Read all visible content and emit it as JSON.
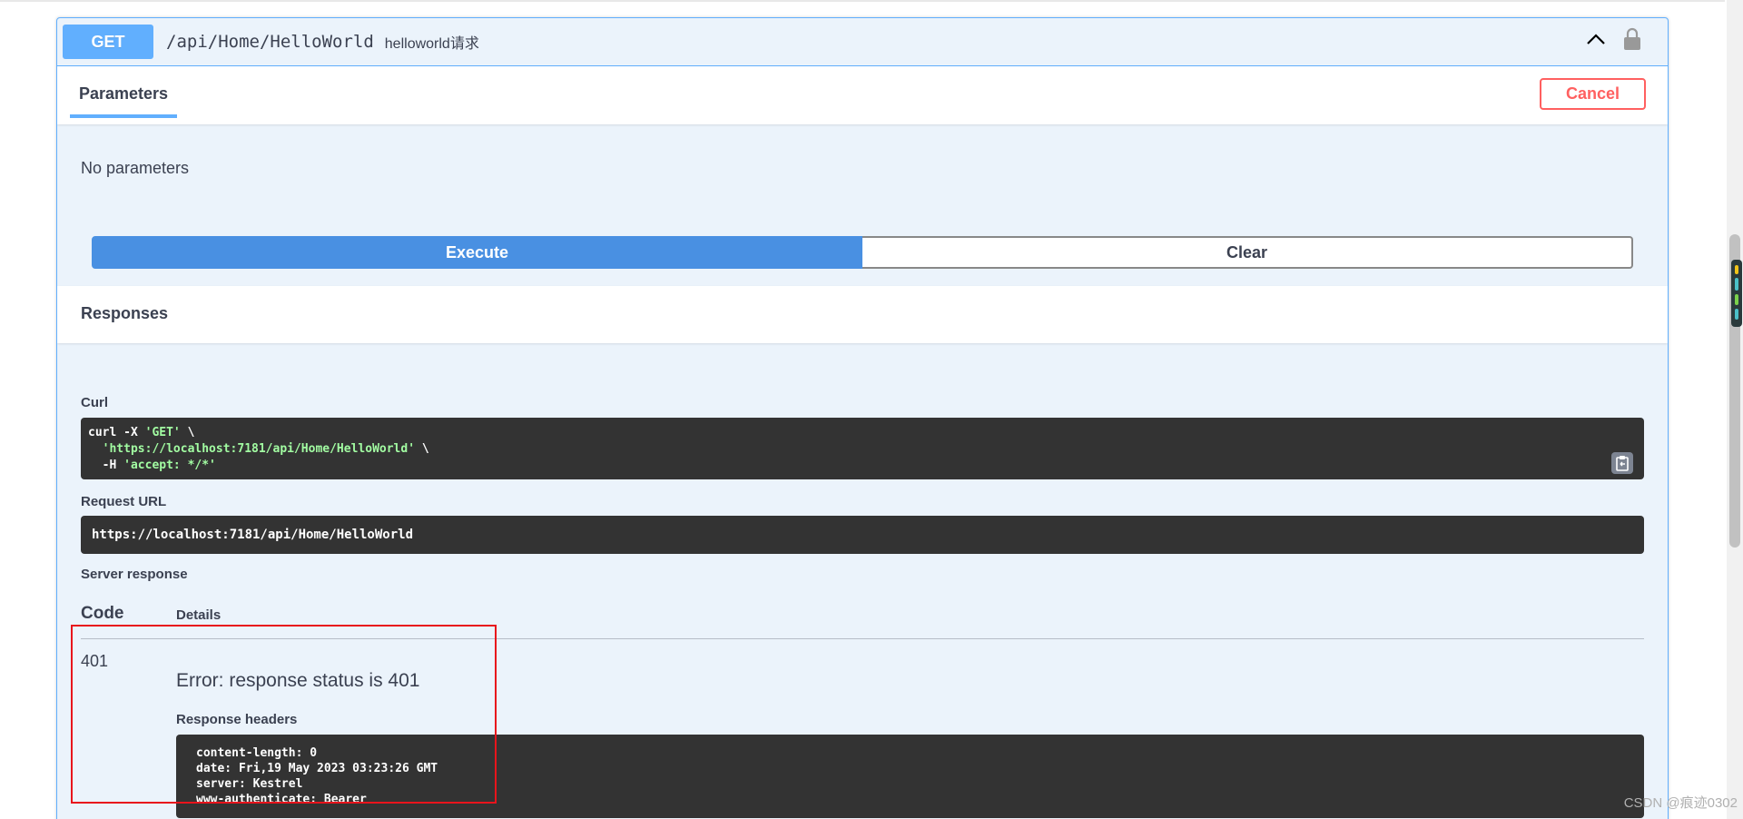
{
  "operation": {
    "method": "GET",
    "path": "/api/Home/HelloWorld",
    "description": "helloworld请求"
  },
  "parameters": {
    "tab_label": "Parameters",
    "cancel_label": "Cancel",
    "empty_text": "No parameters"
  },
  "actions": {
    "execute_label": "Execute",
    "clear_label": "Clear"
  },
  "responses": {
    "title": "Responses",
    "curl_label": "Curl",
    "curl_line1_prefix": "curl -X ",
    "curl_line1_method": "'GET'",
    "curl_line1_suffix": " \\",
    "curl_line2_url": "'https://localhost:7181/api/Home/HelloWorld'",
    "curl_line2_suffix": " \\",
    "curl_line3_prefix": "  -H ",
    "curl_line3_header": "'accept: */*'",
    "request_url_label": "Request URL",
    "request_url": "https://localhost:7181/api/Home/HelloWorld",
    "server_response_label": "Server response",
    "col_code": "Code",
    "col_details": "Details",
    "status_code": "401",
    "error_text": "Error: response status is 401",
    "response_headers_label": "Response headers",
    "headers": [
      "content-length: 0",
      "date: Fri,19 May 2023 03:23:26 GMT",
      "server: Kestrel",
      "www-authenticate: Bearer"
    ]
  },
  "watermark": "CSDN @痕迹0302",
  "icons": {
    "collapse": "chevron-up-icon",
    "lock": "lock-icon",
    "copy": "clipboard-icon"
  },
  "colors": {
    "get_accent": "#61affe",
    "execute": "#4990e2",
    "cancel": "#ff6060",
    "code_bg": "#333333",
    "highlight": "#e8141c"
  }
}
